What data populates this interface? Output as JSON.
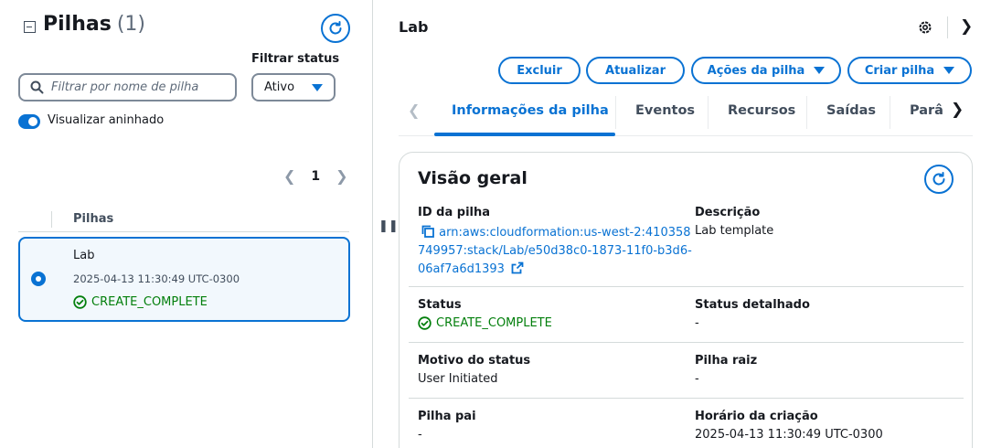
{
  "left_panel": {
    "title": "Pilhas",
    "count": "(1)",
    "filter_status_label": "Filtrar status",
    "search_placeholder": "Filtrar por nome de pilha",
    "status_selected": "Ativo",
    "toggle_label": "Visualizar aninhado",
    "page_number": "1",
    "column_header": "Pilhas",
    "stacks": [
      {
        "name": "Lab",
        "created": "2025-04-13 11:30:49 UTC-0300",
        "status": "CREATE_COMPLETE"
      }
    ]
  },
  "right_panel": {
    "title": "Lab",
    "buttons": {
      "delete": "Excluir",
      "update": "Atualizar",
      "stack_actions": "Ações da pilha",
      "create_stack": "Criar pilha"
    },
    "tabs": [
      "Informações da pilha",
      "Eventos",
      "Recursos",
      "Saídas",
      "Parâ"
    ],
    "active_tab": "Informações da pilha",
    "overview": {
      "title": "Visão geral",
      "stack_id_label": "ID da pilha",
      "stack_id_value": "arn:aws:cloudformation:us-west-2:410358749957:stack/Lab/e50d38c0-1873-11f0-b3d6-06af7a6d1393",
      "description_label": "Descrição",
      "description_value": "Lab template",
      "status_label": "Status",
      "status_value": "CREATE_COMPLETE",
      "detailed_status_label": "Status detalhado",
      "detailed_status_value": "-",
      "status_reason_label": "Motivo do status",
      "status_reason_value": "User Initiated",
      "root_stack_label": "Pilha raiz",
      "root_stack_value": "-",
      "parent_stack_label": "Pilha pai",
      "parent_stack_value": "-",
      "creation_time_label": "Horário da criação",
      "creation_time_value": "2025-04-13 11:30:49 UTC-0300"
    }
  },
  "colors": {
    "accent": "#0972d3",
    "success": "#037f0c",
    "selected_bg": "#f2f8fd"
  }
}
